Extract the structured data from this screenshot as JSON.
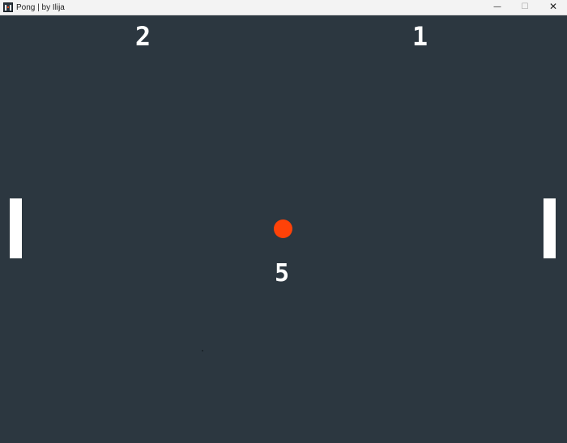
{
  "window": {
    "title": "Pong | by Ilija",
    "icon": "pong-app-icon",
    "controls": {
      "minimize": "—",
      "maximize": "☐",
      "close": "✕"
    }
  },
  "game": {
    "score_left": "2",
    "score_right": "1",
    "countdown": "5",
    "colors": {
      "background": "#2c3740",
      "paddle": "#ffffff",
      "ball": "#ff4208",
      "text": "#ffffff"
    }
  }
}
